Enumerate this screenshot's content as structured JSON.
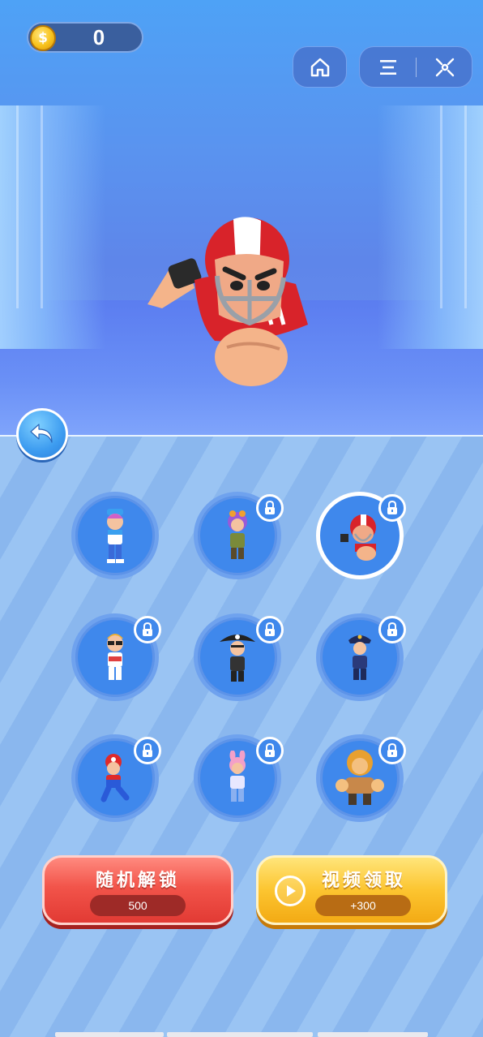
{
  "coins": {
    "value": "0",
    "symbol": "$"
  },
  "top_controls": {
    "home_icon": "home-icon",
    "menu_icon": "menu-icon",
    "close_icon": "close-target-icon"
  },
  "colors": {
    "coin": "#f8c21b",
    "slot": "#3f88ec",
    "random_btn": "#e23a34",
    "video_btn": "#fcc530"
  },
  "characters": [
    {
      "name": "blue-cap-player",
      "locked": false,
      "selected": false
    },
    {
      "name": "purple-hair-explorer",
      "locked": true,
      "selected": false
    },
    {
      "name": "football-player",
      "locked": true,
      "selected": true
    },
    {
      "name": "sunglasses-guy",
      "locked": true,
      "selected": false
    },
    {
      "name": "pirate",
      "locked": true,
      "selected": false
    },
    {
      "name": "police-officer",
      "locked": true,
      "selected": false
    },
    {
      "name": "red-cap-plumber",
      "locked": true,
      "selected": false
    },
    {
      "name": "bunny-girl",
      "locked": true,
      "selected": false
    },
    {
      "name": "lion-warrior",
      "locked": true,
      "selected": false
    }
  ],
  "buttons": {
    "random_unlock": {
      "label": "随机解锁",
      "price": "500"
    },
    "video_claim": {
      "label": "视频领取",
      "reward": "+300"
    }
  }
}
